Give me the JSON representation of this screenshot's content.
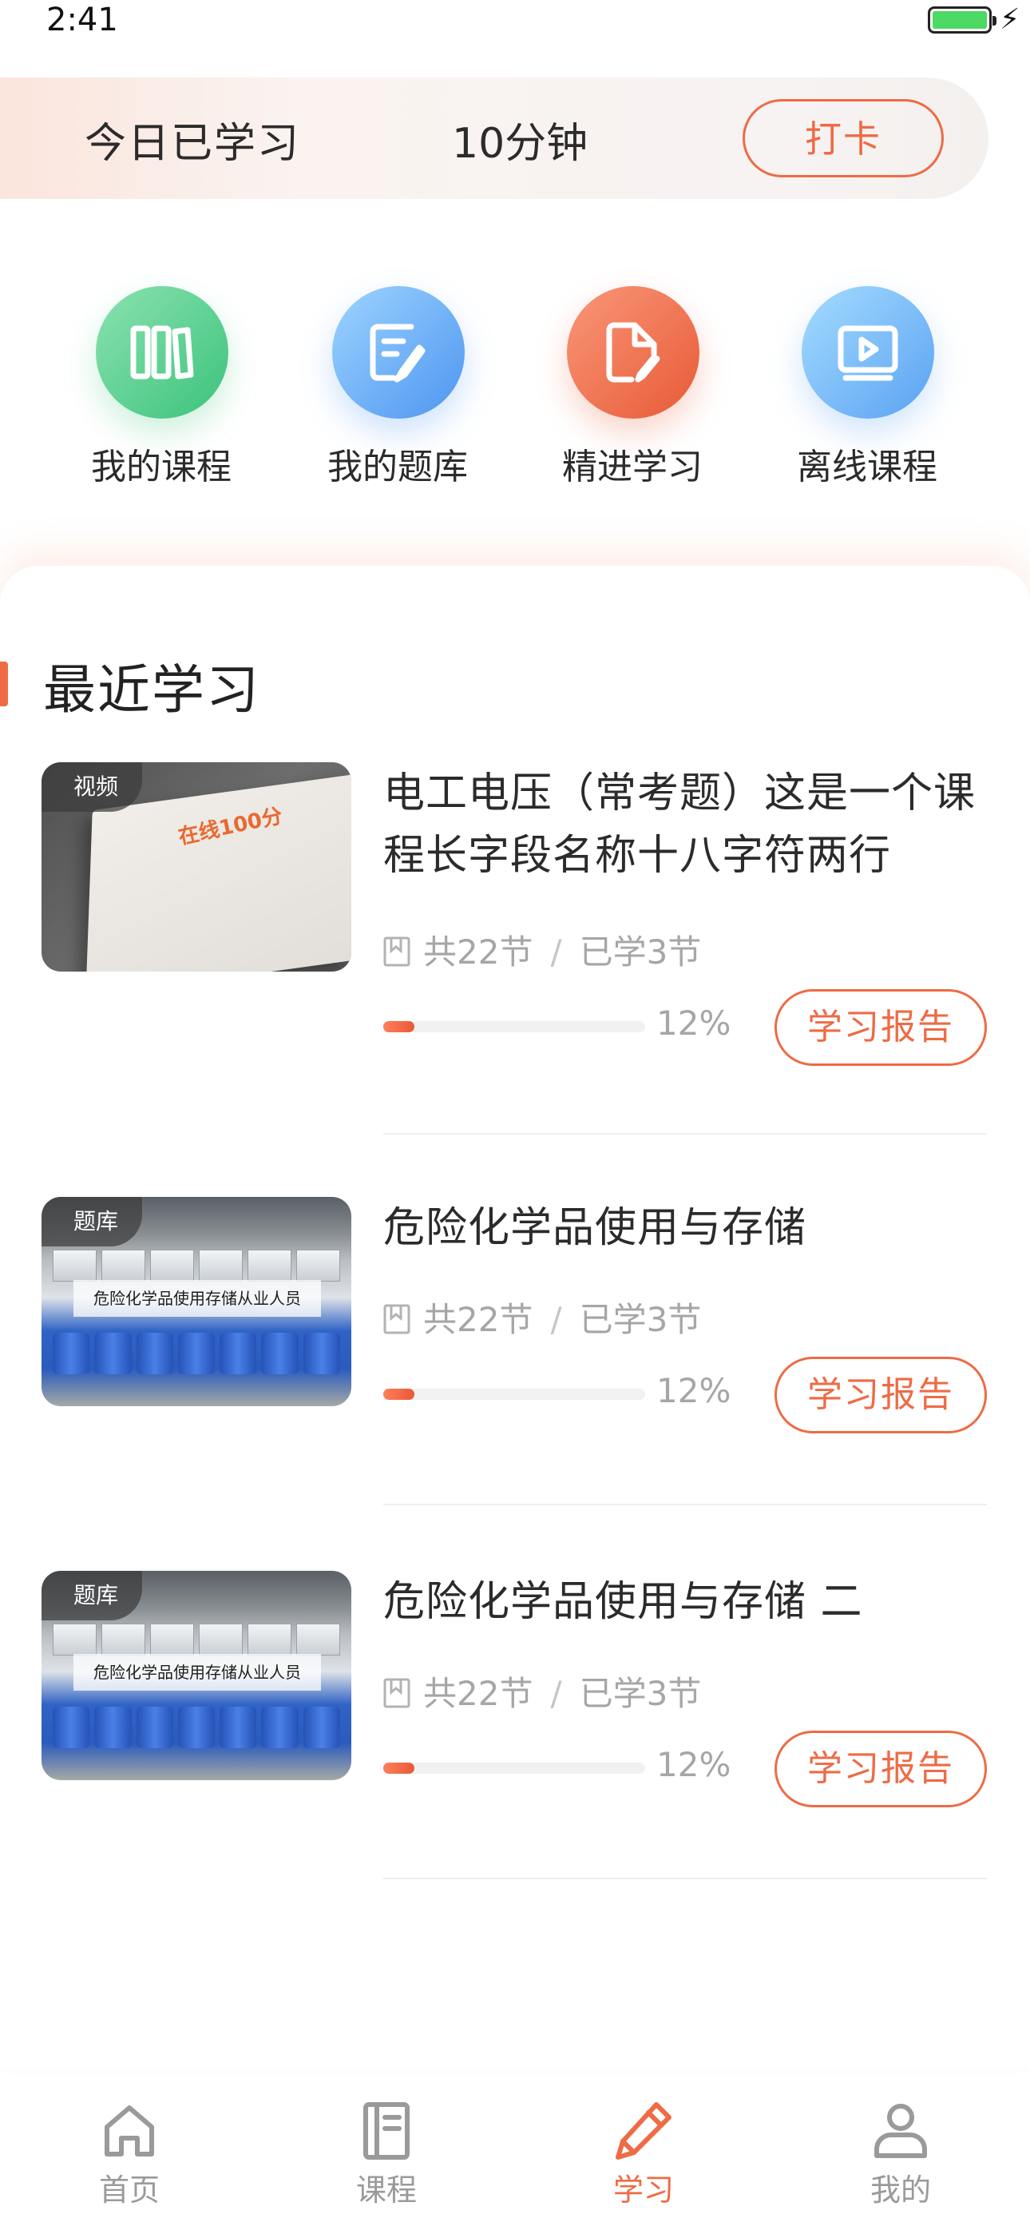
{
  "status_bar": {
    "time": "2:41"
  },
  "checkin": {
    "label": "今日已学习",
    "minutes": "10分钟",
    "button": "打卡"
  },
  "quick_actions": [
    {
      "label": "我的课程",
      "icon": "books-icon",
      "color": "#3cc37c"
    },
    {
      "label": "我的题库",
      "icon": "edit-document-icon",
      "color": "#4d95f0"
    },
    {
      "label": "精进学习",
      "icon": "file-edit-icon",
      "color": "#e85a35"
    },
    {
      "label": "离线课程",
      "icon": "video-play-icon",
      "color": "#5aa2f2"
    }
  ],
  "recent": {
    "title": "最近学习",
    "items": [
      {
        "tag": "视频",
        "title": "电工电压（常考题）这是一个课程长字段名称十八字符两行",
        "thumb_text": "在线100分",
        "total": "共22节",
        "learned": "已学3节",
        "progress": 12,
        "progress_text": "12%",
        "report": "学习报告"
      },
      {
        "tag": "题库",
        "title": "危险化学品使用与存储",
        "thumb_text": "危险化学品使用存储从业人员",
        "total": "共22节",
        "learned": "已学3节",
        "progress": 12,
        "progress_text": "12%",
        "report": "学习报告"
      },
      {
        "tag": "题库",
        "title": "危险化学品使用与存储 二",
        "thumb_text": "危险化学品使用存储从业人员",
        "total": "共22节",
        "learned": "已学3节",
        "progress": 12,
        "progress_text": "12%",
        "report": "学习报告"
      }
    ]
  },
  "tab_bar": {
    "active": 2,
    "tabs": [
      {
        "label": "首页",
        "icon": "home-icon"
      },
      {
        "label": "课程",
        "icon": "book-icon"
      },
      {
        "label": "学习",
        "icon": "pencil-icon"
      },
      {
        "label": "我的",
        "icon": "profile-icon"
      }
    ]
  },
  "colors": {
    "accent": "#ee6b45",
    "text": "#2b2b2b",
    "muted": "#a6a6a6"
  }
}
